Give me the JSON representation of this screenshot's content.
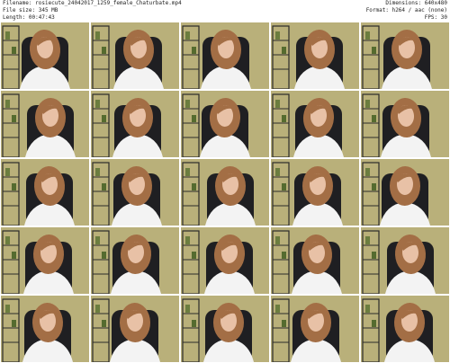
{
  "header": {
    "filename_label": "Filename: rosiecute_24042017_1259_female_Chaturbate.mp4",
    "filesize_label": "File size: 345 MB",
    "length_label": "Length: 00:47:43",
    "dimensions_label": "Dimensions: 640x480",
    "format_label": "Format: h264 / aac (none)",
    "fps_label": "FPS: 30"
  },
  "thumbnails": [
    {
      "scene": "webcam-frame"
    },
    {
      "scene": "webcam-frame"
    },
    {
      "scene": "webcam-frame"
    },
    {
      "scene": "webcam-frame"
    },
    {
      "scene": "webcam-frame"
    },
    {
      "scene": "webcam-frame"
    },
    {
      "scene": "webcam-frame"
    },
    {
      "scene": "webcam-frame"
    },
    {
      "scene": "webcam-frame"
    },
    {
      "scene": "webcam-frame"
    },
    {
      "scene": "webcam-frame"
    },
    {
      "scene": "webcam-frame"
    },
    {
      "scene": "webcam-frame"
    },
    {
      "scene": "webcam-frame"
    },
    {
      "scene": "webcam-frame"
    },
    {
      "scene": "webcam-frame"
    },
    {
      "scene": "webcam-frame"
    },
    {
      "scene": "webcam-frame"
    },
    {
      "scene": "webcam-frame"
    },
    {
      "scene": "webcam-frame"
    },
    {
      "scene": "webcam-frame"
    },
    {
      "scene": "webcam-frame"
    },
    {
      "scene": "webcam-frame"
    },
    {
      "scene": "webcam-frame"
    },
    {
      "scene": "webcam-frame"
    }
  ],
  "colors": {
    "wall": "#b9b07a",
    "shelf": "#2b2b2b",
    "chair": "#1f1f22",
    "hair": "#a36e45",
    "skin": "#e8c1a6",
    "shirt": "#f3f3f3"
  }
}
